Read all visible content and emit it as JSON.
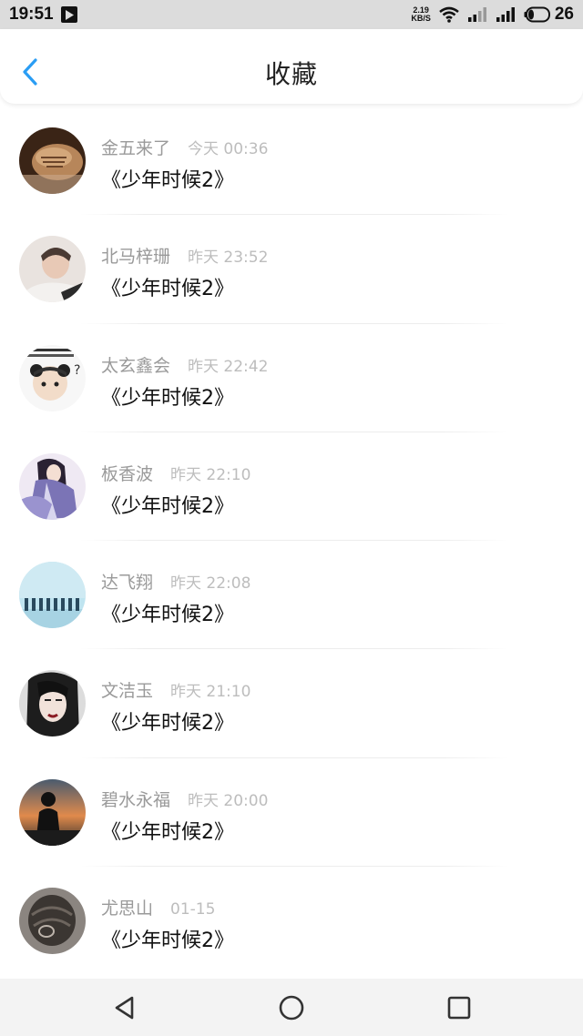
{
  "status_bar": {
    "time": "19:51",
    "net_speed_value": "2.19",
    "net_speed_unit": "KB/S",
    "battery_level": "26",
    "icons": [
      "media-play-icon",
      "wifi-icon",
      "signal-icon",
      "signal-icon",
      "battery-icon"
    ]
  },
  "header": {
    "title": "收藏",
    "back_icon": "chevron-left-icon",
    "accent_color": "#2a9df4"
  },
  "favorites": [
    {
      "name": "金五来了",
      "time": "今天 00:36",
      "content": "《少年时候2》"
    },
    {
      "name": "北马梓珊",
      "time": "昨天 23:52",
      "content": "《少年时候2》"
    },
    {
      "name": "太玄鑫会",
      "time": "昨天 22:42",
      "content": "《少年时候2》"
    },
    {
      "name": "板香波",
      "time": "昨天 22:10",
      "content": "《少年时候2》"
    },
    {
      "name": "达飞翔",
      "time": "昨天 22:08",
      "content": "《少年时候2》"
    },
    {
      "name": "文洁玉",
      "time": "昨天 21:10",
      "content": "《少年时候2》"
    },
    {
      "name": "碧水永福",
      "time": "昨天 20:00",
      "content": "《少年时候2》"
    },
    {
      "name": "尤思山",
      "time": "01-15",
      "content": "《少年时候2》"
    }
  ],
  "nav_bar": {
    "icons": [
      "back-triangle-icon",
      "home-circle-icon",
      "recents-square-icon"
    ]
  }
}
